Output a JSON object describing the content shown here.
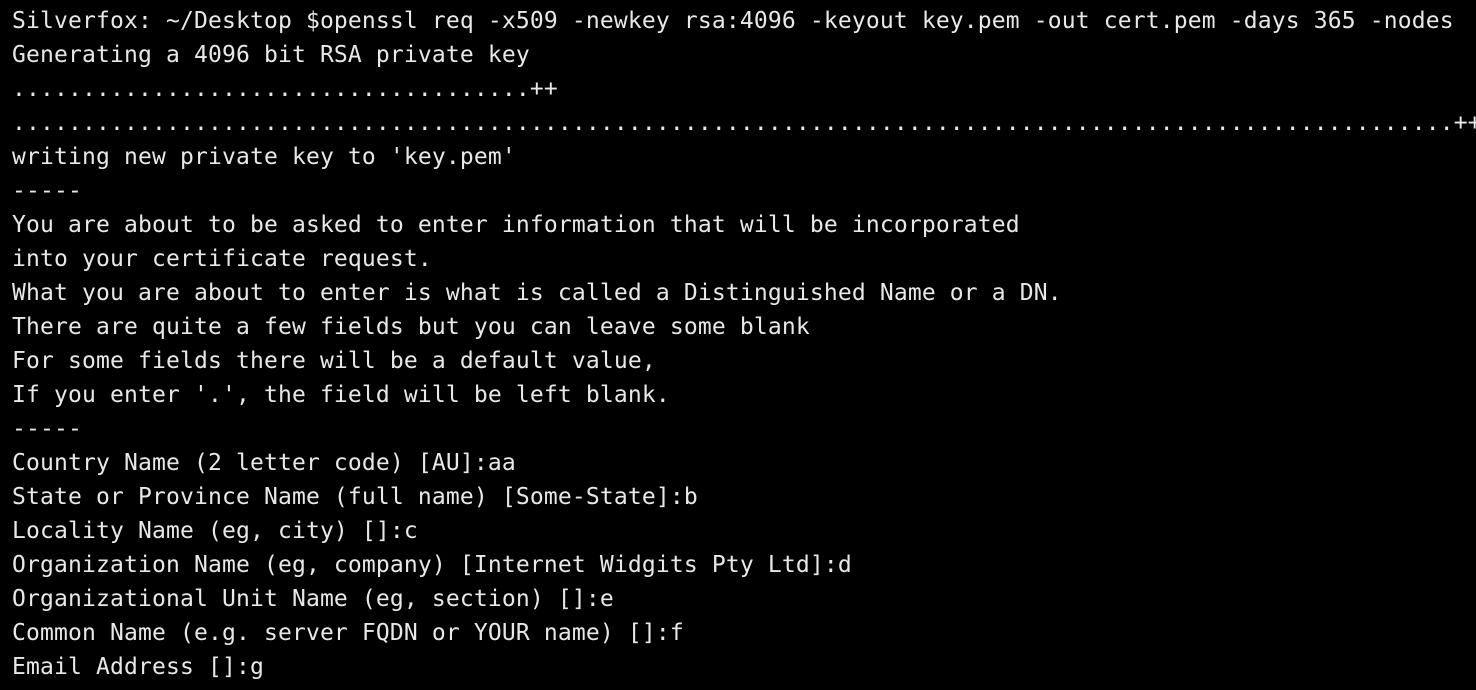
{
  "terminal": {
    "lines": [
      "Silverfox: ~/Desktop $openssl req -x509 -newkey rsa:4096 -keyout key.pem -out cert.pem -days 365 -nodes",
      "Generating a 4096 bit RSA private key",
      ".....................................++",
      ".......................................................................................................++",
      "writing new private key to 'key.pem'",
      "-----",
      "You are about to be asked to enter information that will be incorporated",
      "into your certificate request.",
      "What you are about to enter is what is called a Distinguished Name or a DN.",
      "There are quite a few fields but you can leave some blank",
      "For some fields there will be a default value,",
      "If you enter '.', the field will be left blank.",
      "-----",
      "Country Name (2 letter code) [AU]:aa",
      "State or Province Name (full name) [Some-State]:b",
      "Locality Name (eg, city) []:c",
      "Organization Name (eg, company) [Internet Widgits Pty Ltd]:d",
      "Organizational Unit Name (eg, section) []:e",
      "Common Name (e.g. server FQDN or YOUR name) []:f",
      "Email Address []:g"
    ]
  }
}
